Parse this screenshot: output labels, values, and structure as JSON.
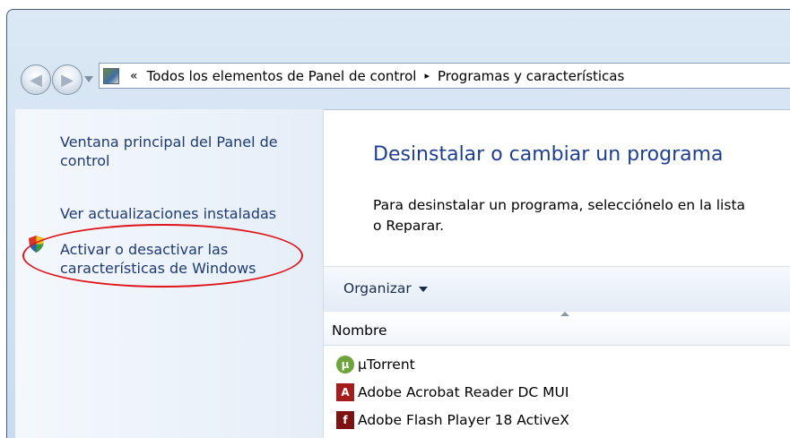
{
  "breadcrumb": {
    "chevron": "«",
    "items": [
      "Todos los elementos de Panel de control",
      "Programas y características"
    ],
    "separator": "▸"
  },
  "sidebar": {
    "links": [
      {
        "label": "Ventana principal del Panel de control"
      },
      {
        "label": "Ver actualizaciones instaladas"
      },
      {
        "label": "Activar o desactivar las características de Windows"
      }
    ]
  },
  "main": {
    "title": "Desinstalar o cambiar un programa",
    "description_line1": "Para desinstalar un programa, selecciónelo en la lista",
    "description_line2": "o Reparar."
  },
  "toolbar": {
    "organize_label": "Organizar"
  },
  "list": {
    "column": "Nombre",
    "programs": [
      {
        "name": "µTorrent",
        "icon": "utorrent-icon"
      },
      {
        "name": "Adobe Acrobat Reader DC MUI",
        "icon": "acrobat-icon"
      },
      {
        "name": "Adobe Flash Player 18 ActiveX",
        "icon": "flash-icon"
      }
    ]
  },
  "colors": {
    "link": "#1f3a73",
    "title": "#1e3f8f",
    "highlight": "#e0141b"
  }
}
